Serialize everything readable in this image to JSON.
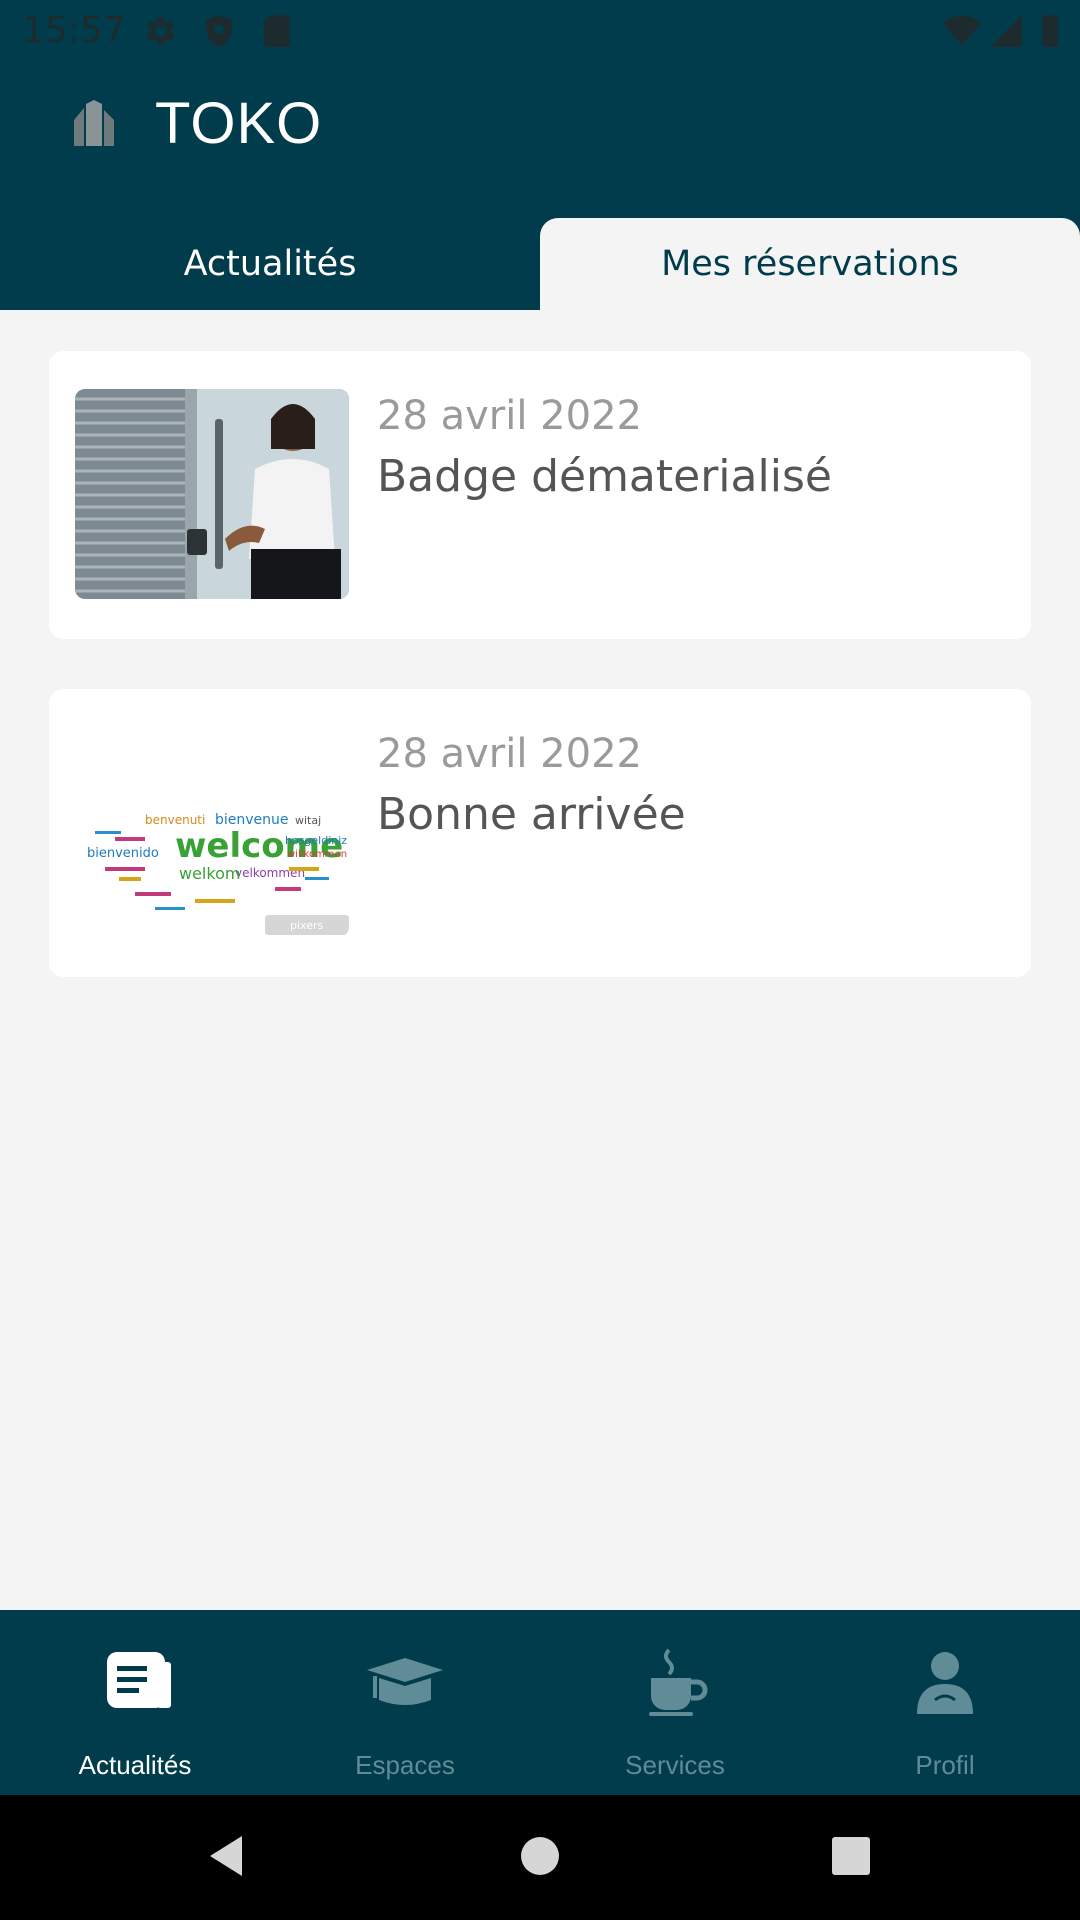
{
  "status_bar": {
    "time": "15:57"
  },
  "app": {
    "title": "TOKO"
  },
  "tabs": [
    {
      "label": "Actualités",
      "active": false
    },
    {
      "label": "Mes réservations",
      "active": true
    }
  ],
  "news": [
    {
      "date": "28 avril 2022",
      "title": "Badge dématerialisé",
      "image": "woman-at-door-photo"
    },
    {
      "date": "28 avril 2022",
      "title": "Bonne arrivée",
      "image": "welcome-word-cloud",
      "cloud_words": [
        "bienvenue",
        "benvenuti",
        "welcome",
        "bienvenido",
        "velkommen",
        "welkom",
        "hosgeldiniz",
        "witaj",
        "willkommen"
      ],
      "watermark": "pixers"
    }
  ],
  "bottom_nav": [
    {
      "label": "Actualités",
      "icon": "news-icon",
      "active": true
    },
    {
      "label": "Espaces",
      "icon": "graduation-cap-icon",
      "active": false
    },
    {
      "label": "Services",
      "icon": "coffee-cup-icon",
      "active": false
    },
    {
      "label": "Profil",
      "icon": "person-icon",
      "active": false
    }
  ],
  "colors": {
    "primary": "#003c4b",
    "background": "#f4f4f4",
    "inactive_nav": "#5f8c96"
  }
}
